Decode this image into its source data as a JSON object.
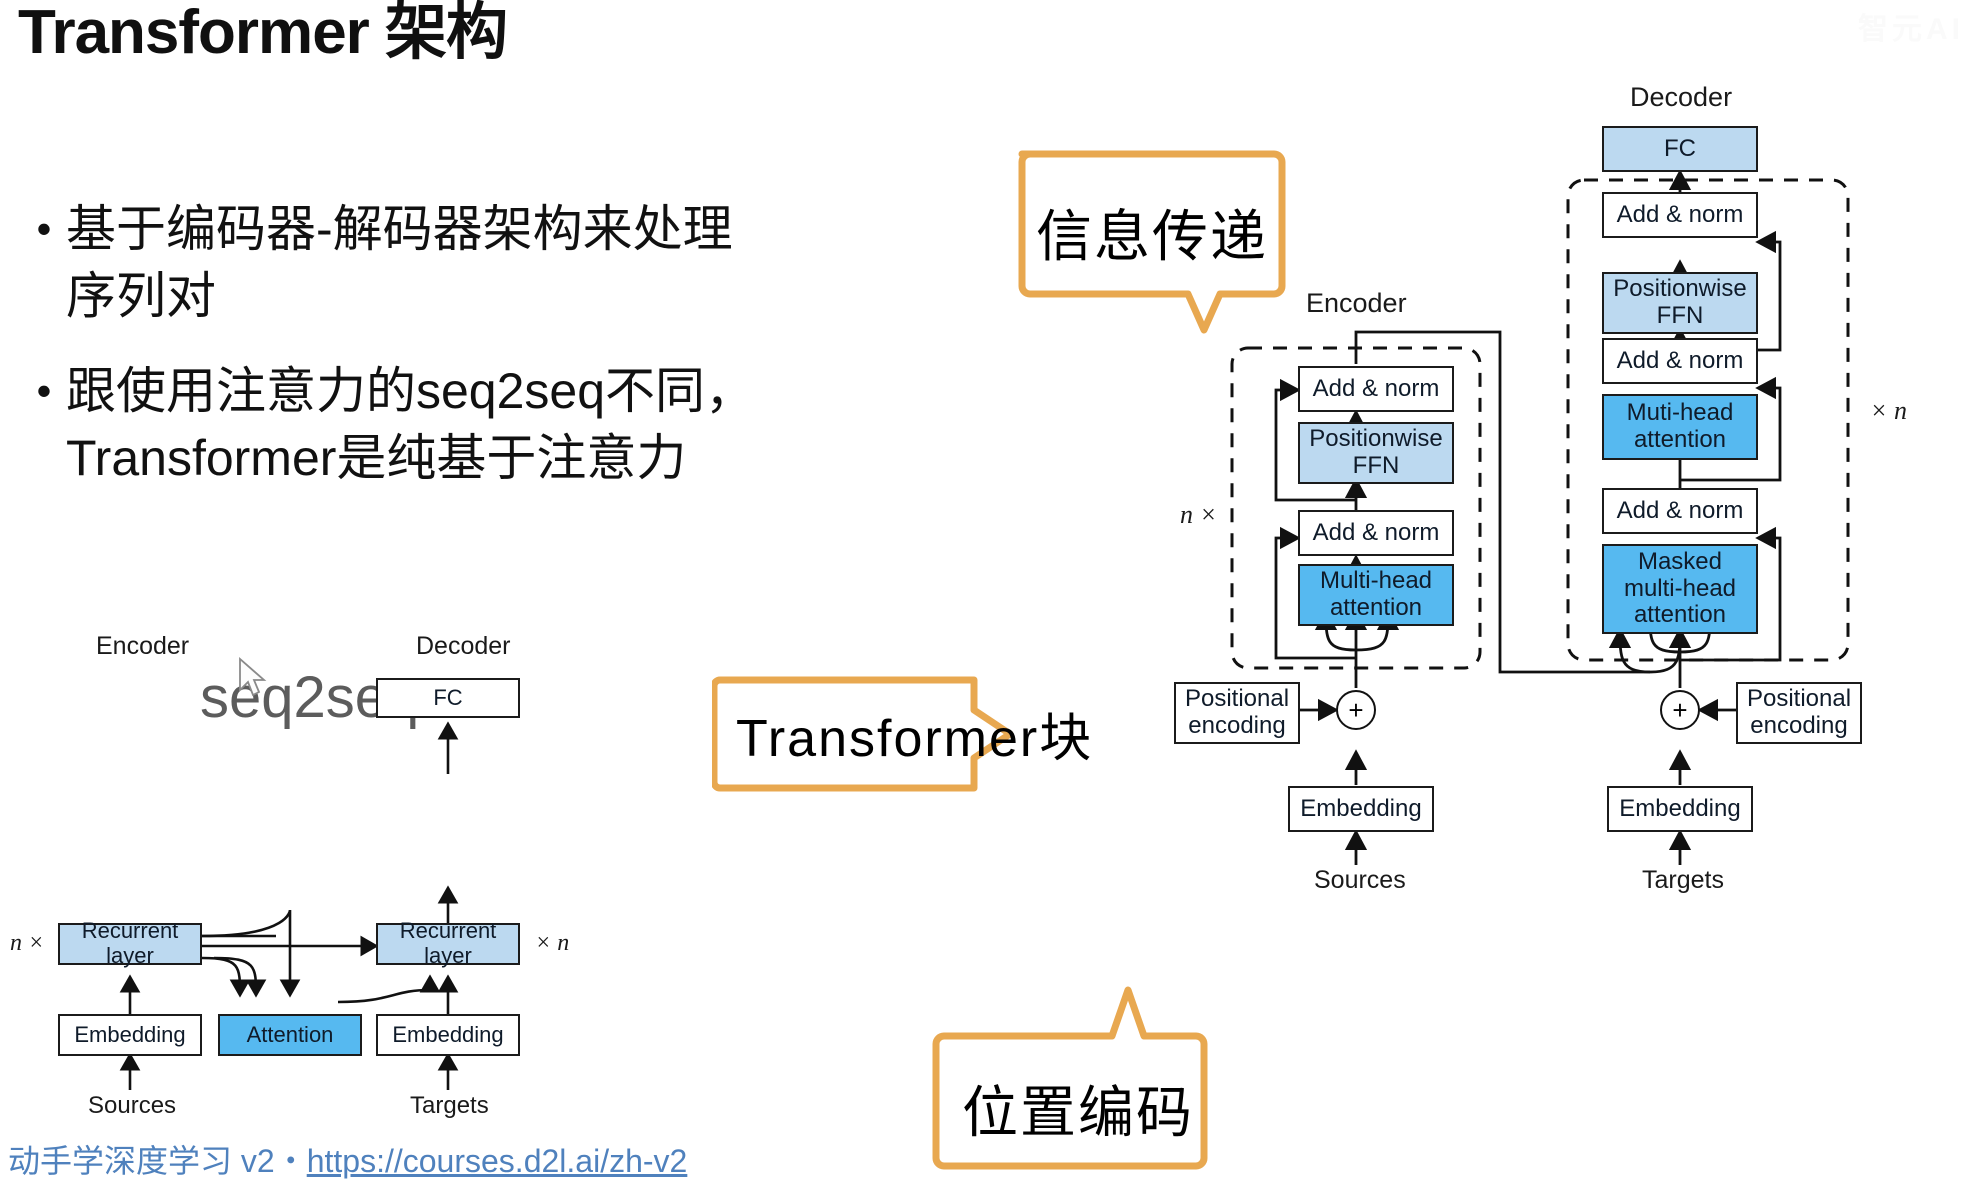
{
  "slide": {
    "title": "Transformer 架构",
    "watermark": "智元AI",
    "bullets": [
      {
        "marker": "•",
        "lines": [
          "基于编码器-解码器架构来处理",
          "序列对"
        ]
      },
      {
        "marker": "•",
        "lines": [
          "跟使用注意力的seq2seq不同，",
          "Transformer是纯基于注意力"
        ]
      }
    ],
    "footer": {
      "prefix": "动手学深度学习 v2・",
      "link": "https://courses.d2l.ai/zh-v2"
    }
  },
  "seq2seq_diagram": {
    "caption": "seq2seq",
    "encoder_label": "Encoder",
    "decoder_label": "Decoder",
    "left_multiplier": "n ×",
    "right_multiplier": "× n",
    "blocks": {
      "fc": "FC",
      "recurrent_layer_left": "Recurrent layer",
      "recurrent_layer_right": "Recurrent layer",
      "embedding_left": "Embedding",
      "attention": "Attention",
      "embedding_right": "Embedding"
    },
    "inputs": {
      "sources": "Sources",
      "targets": "Targets"
    }
  },
  "transformer_diagram": {
    "encoder_label": "Encoder",
    "decoder_label": "Decoder",
    "encoder_multiplier": "n ×",
    "decoder_multiplier": "× n",
    "encoder": {
      "add_norm_top": "Add & norm",
      "positionwise_ffn": "Positionwise\nFFN",
      "add_norm_bottom": "Add & norm",
      "multi_head_attention": "Multi-head\nattention",
      "positional_encoding": "Positional\nencoding",
      "plus": "+",
      "embedding": "Embedding",
      "input": "Sources"
    },
    "decoder": {
      "fc": "FC",
      "add_norm_top": "Add & norm",
      "positionwise_ffn": "Positionwise\nFFN",
      "add_norm_mid": "Add & norm",
      "multi_head_attention": "Muti-head\nattention",
      "add_norm_bottom": "Add & norm",
      "masked_multi_head_attention": "Masked\nmulti-head\nattention",
      "positional_encoding": "Positional\nencoding",
      "plus": "+",
      "embedding": "Embedding",
      "input": "Targets"
    }
  },
  "callouts": {
    "info_pass": "信息传递",
    "transformer_block": "Transformer块",
    "positional_encoding": "位置编码"
  },
  "colors": {
    "callout_border": "#e8a850",
    "light_blue": "#bcd9f0",
    "blue": "#56b9f0",
    "footer_link": "#4f81bd",
    "text": "#111111"
  }
}
